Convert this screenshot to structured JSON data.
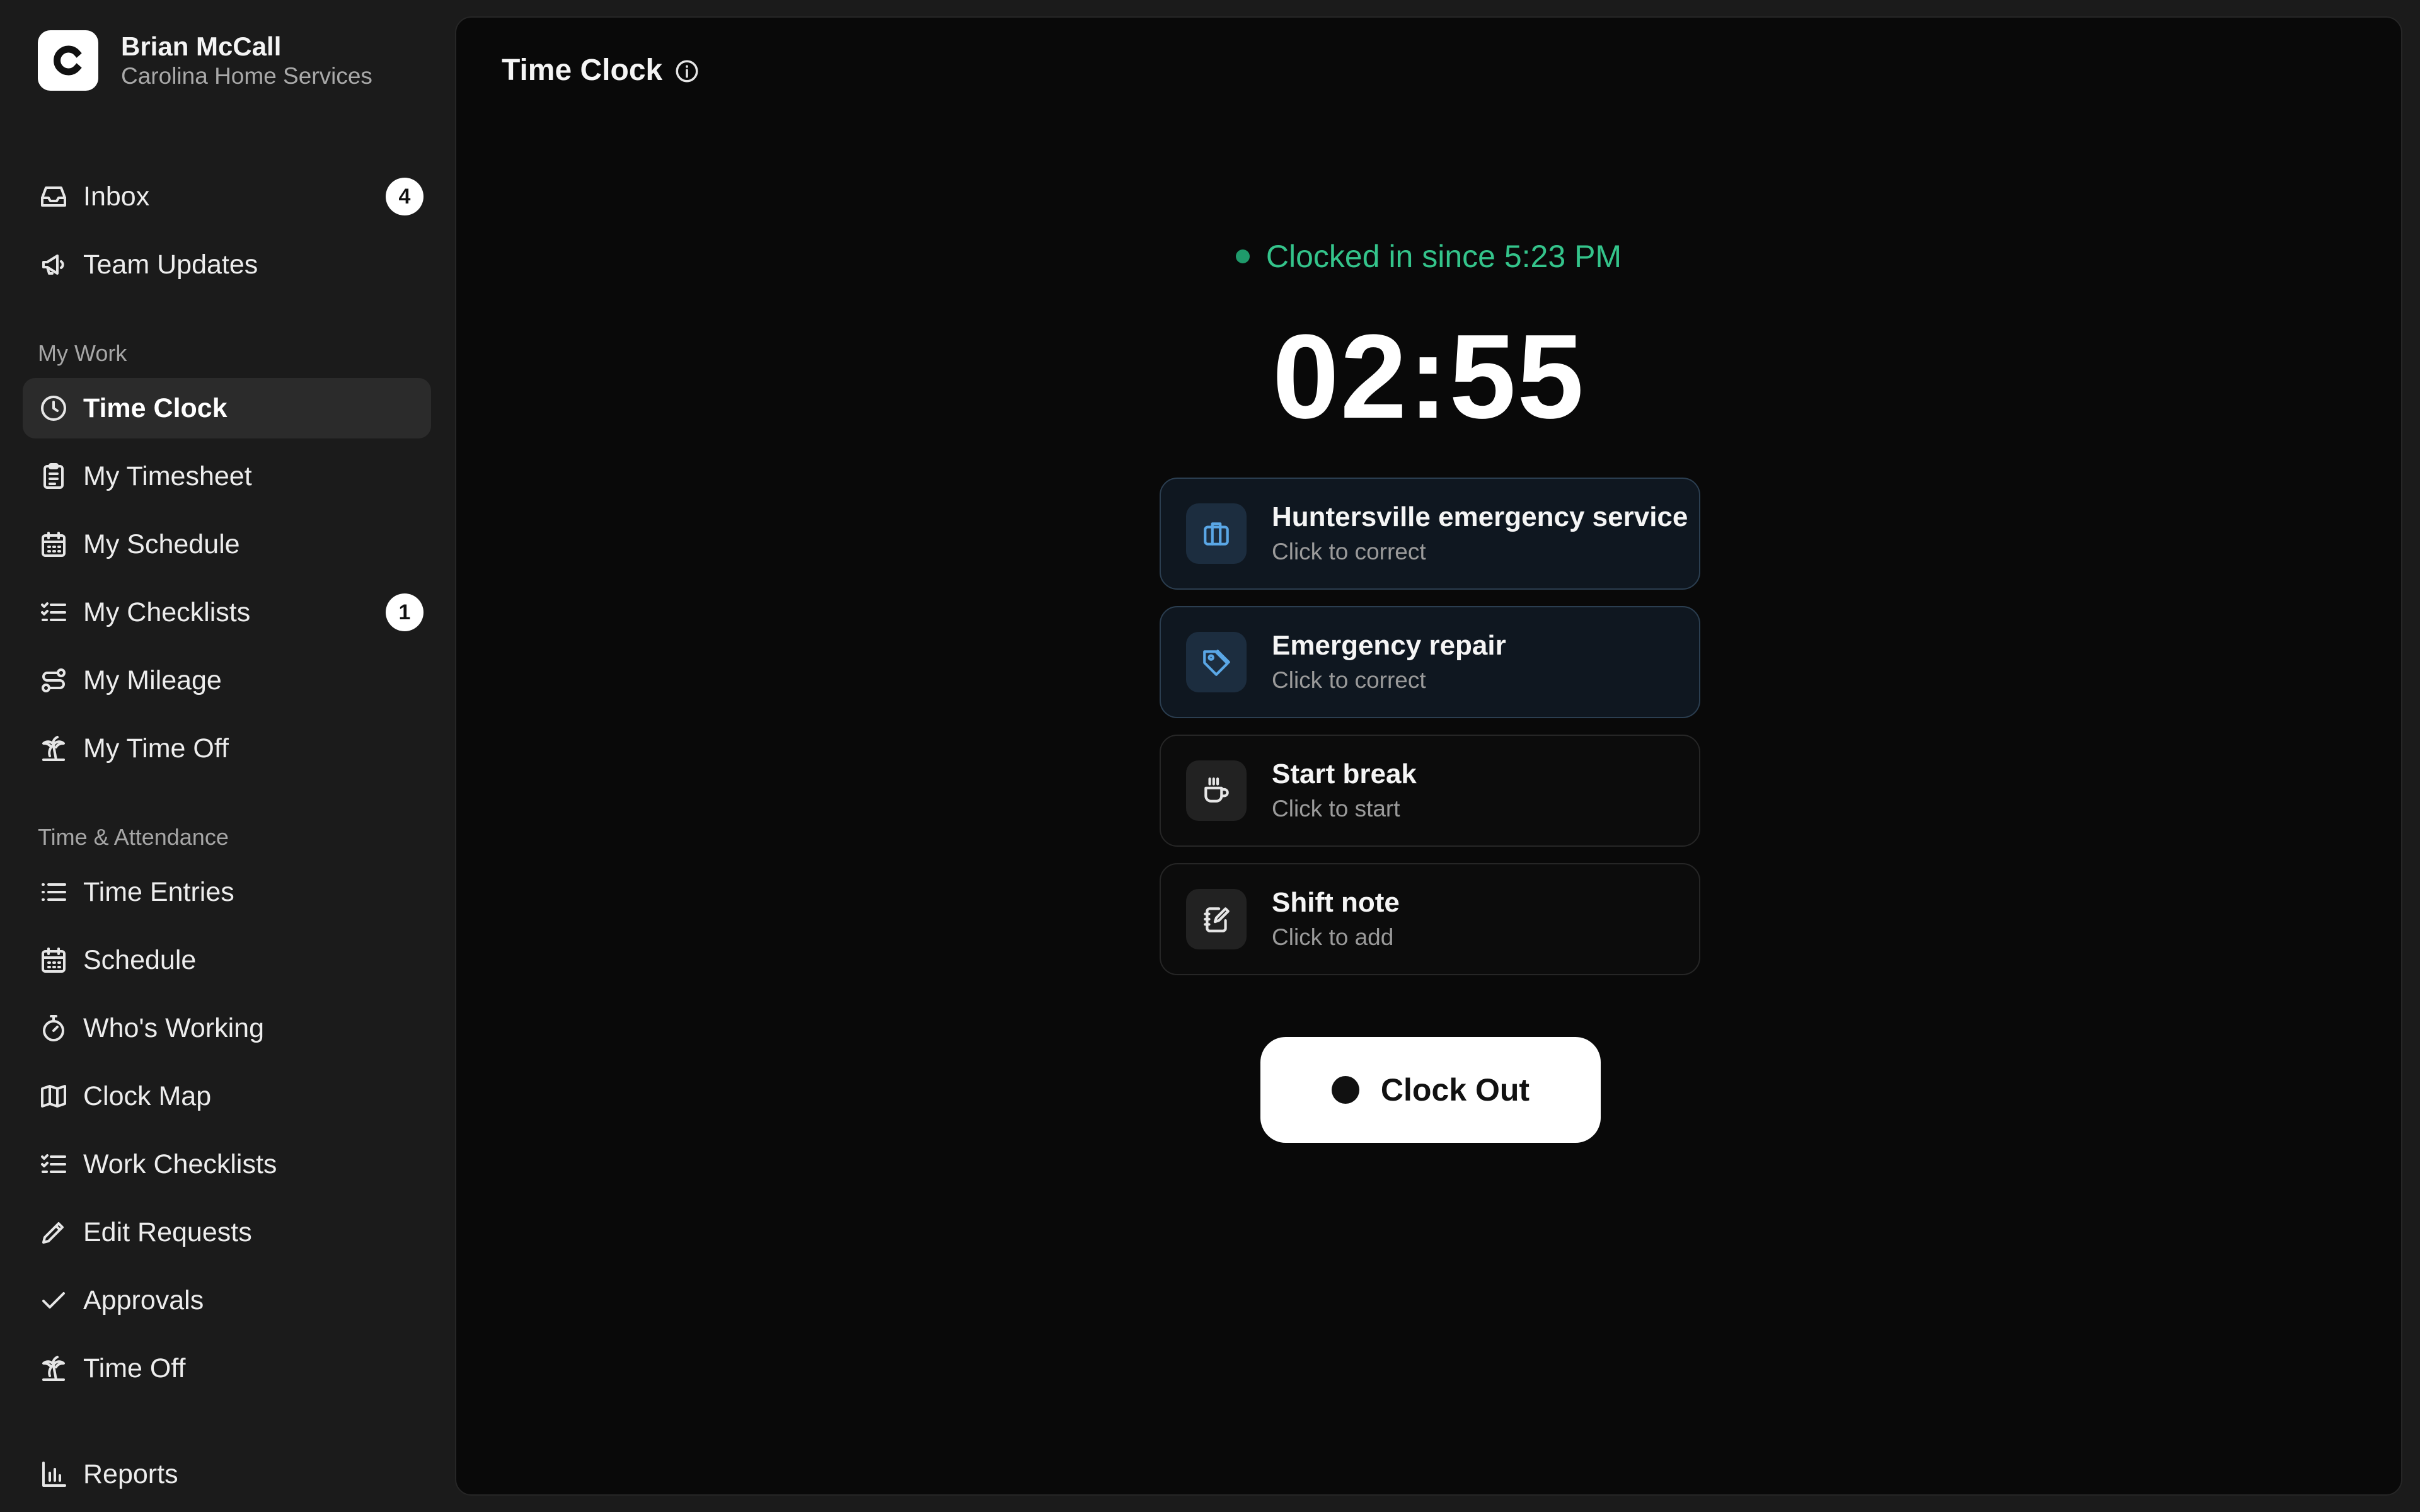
{
  "user": {
    "name": "Brian McCall",
    "org": "Carolina Home Services",
    "logo_letter": "C"
  },
  "nav": {
    "inbox": {
      "label": "Inbox",
      "badge": "4",
      "icon": "inbox-icon"
    },
    "team_updates": {
      "label": "Team Updates",
      "icon": "megaphone-icon"
    },
    "sections": {
      "my_work": "My Work",
      "time_attendance": "Time & Attendance"
    },
    "my_work": [
      {
        "label": "Time Clock",
        "icon": "clock-icon",
        "active": true
      },
      {
        "label": "My Timesheet",
        "icon": "clipboard-icon"
      },
      {
        "label": "My Schedule",
        "icon": "calendar-icon"
      },
      {
        "label": "My Checklists",
        "icon": "checklist-icon",
        "badge": "1"
      },
      {
        "label": "My Mileage",
        "icon": "route-icon"
      },
      {
        "label": "My Time Off",
        "icon": "palm-tree-icon"
      }
    ],
    "time_attendance": [
      {
        "label": "Time Entries",
        "icon": "list-icon"
      },
      {
        "label": "Schedule",
        "icon": "calendar-icon"
      },
      {
        "label": "Who's Working",
        "icon": "stopwatch-icon"
      },
      {
        "label": "Clock Map",
        "icon": "map-icon"
      },
      {
        "label": "Work Checklists",
        "icon": "checklist-icon"
      },
      {
        "label": "Edit Requests",
        "icon": "pencil-icon"
      },
      {
        "label": "Approvals",
        "icon": "check-icon"
      },
      {
        "label": "Time Off",
        "icon": "palm-tree-icon"
      }
    ],
    "reports": {
      "label": "Reports",
      "icon": "bar-chart-icon"
    }
  },
  "main": {
    "title": "Time Clock",
    "status": "Clocked in since 5:23 PM",
    "timer": "02:55",
    "cards": [
      {
        "title": "Huntersville emergency service",
        "subtitle": "Click to correct",
        "icon": "briefcase-icon"
      },
      {
        "title": "Emergency repair",
        "subtitle": "Click to correct",
        "icon": "tag-icon"
      },
      {
        "title": "Start break",
        "subtitle": "Click to start",
        "icon": "coffee-icon"
      },
      {
        "title": "Shift note",
        "subtitle": "Click to add",
        "icon": "note-icon"
      }
    ],
    "clock_out_label": "Clock Out"
  },
  "colors": {
    "sidebar_bg": "#1b1b1b",
    "main_bg": "#090909",
    "status_green": "#34c48b",
    "accent_blue": "#5aa7e6"
  }
}
